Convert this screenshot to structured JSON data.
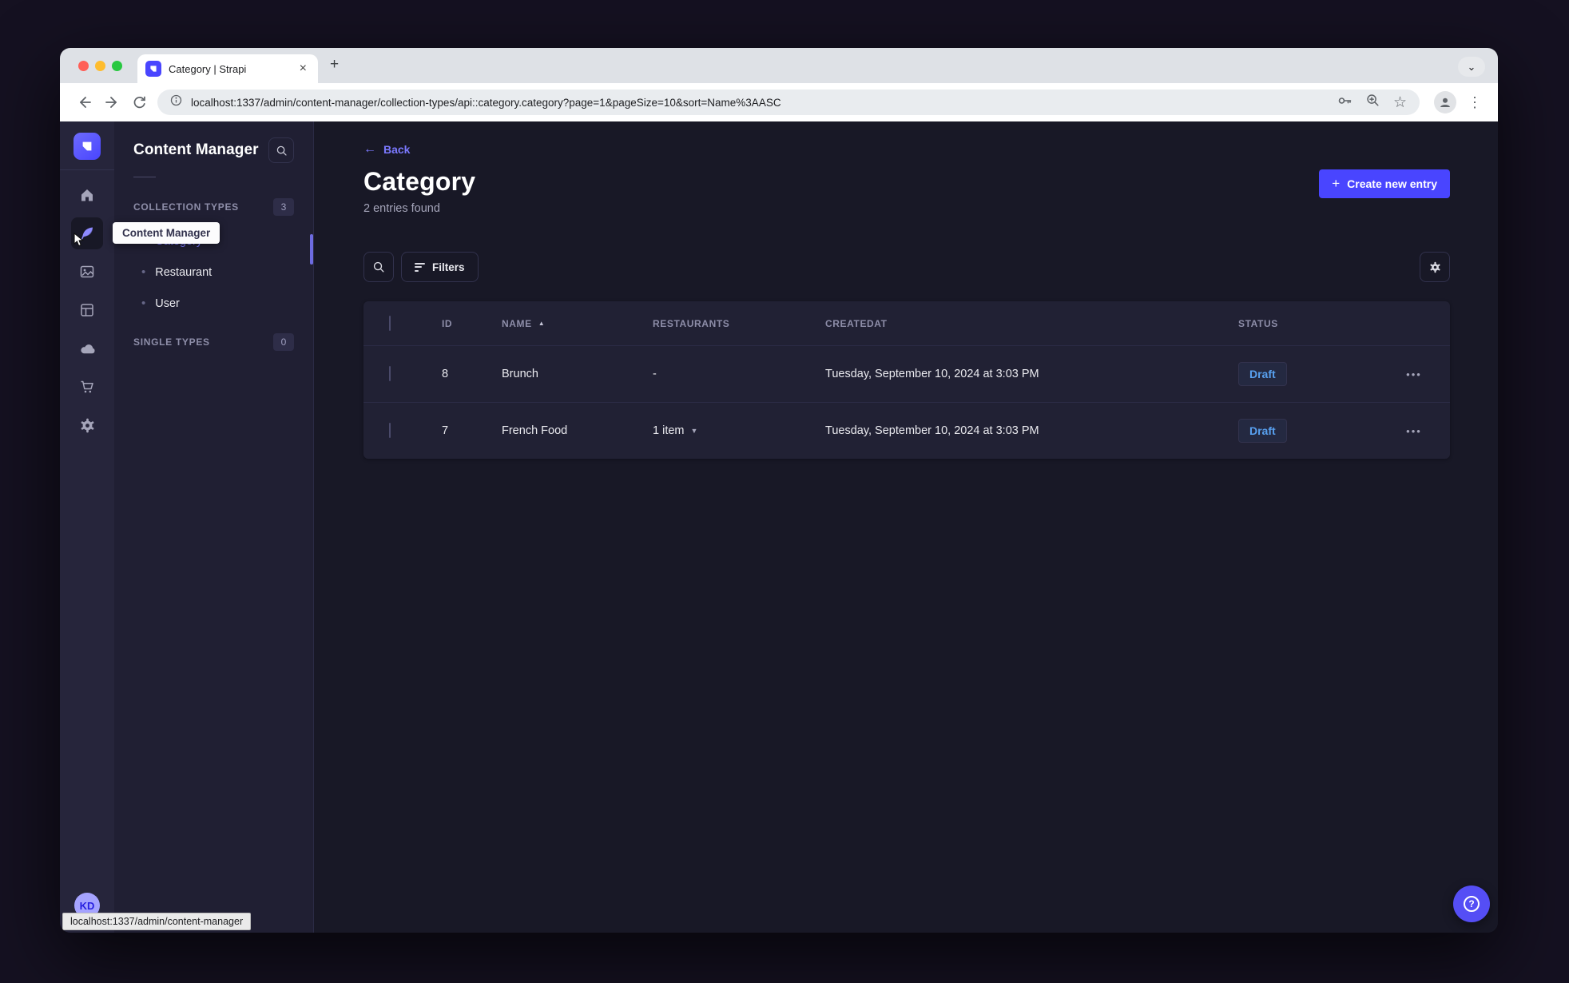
{
  "colors": {
    "primary": "#4945ff",
    "link": "#7b79ff",
    "draft_text": "#58a0ef",
    "page_bg": "#181826",
    "panel_bg": "#212134",
    "border": "#32324d"
  },
  "icons": {
    "back_arrow": "←",
    "plus": "+",
    "tab_close": "×",
    "new_tab": "+",
    "tab_chevron": "⌄",
    "star": "☆",
    "more_vertical": "⋮",
    "row_actions": "•••",
    "sort_asc": "▲",
    "dropdown_chevron": "▼",
    "bullet": "•",
    "question_mark": "?"
  },
  "browser": {
    "tab_title": "Category | Strapi",
    "url": "localhost:1337/admin/content-manager/collection-types/api::category.category?page=1&pageSize=10&sort=Name%3AASC",
    "status_bar_text": "localhost:1337/admin/content-manager"
  },
  "sidebar": {
    "tooltip": "Content Manager",
    "user_initials": "KD"
  },
  "subnav": {
    "title": "Content Manager",
    "collection_types_label": "COLLECTION TYPES",
    "collection_types_count": "3",
    "single_types_label": "SINGLE TYPES",
    "single_types_count": "0",
    "items": [
      {
        "label": "Category"
      },
      {
        "label": "Restaurant"
      },
      {
        "label": "User"
      }
    ]
  },
  "page": {
    "back_label": "Back",
    "title": "Category",
    "subtitle": "2 entries found",
    "create_button_label": "Create new entry",
    "filters_label": "Filters"
  },
  "table": {
    "headers": {
      "id": "ID",
      "name": "NAME",
      "restaurants": "RESTAURANTS",
      "createdat": "CREATEDAT",
      "status": "STATUS"
    },
    "rows": [
      {
        "id": "8",
        "name": "Brunch",
        "restaurants": "-",
        "createdat": "Tuesday, September 10, 2024 at 3:03 PM",
        "status": "Draft"
      },
      {
        "id": "7",
        "name": "French Food",
        "restaurants": "1 item",
        "createdat": "Tuesday, September 10, 2024 at 3:03 PM",
        "status": "Draft"
      }
    ]
  }
}
